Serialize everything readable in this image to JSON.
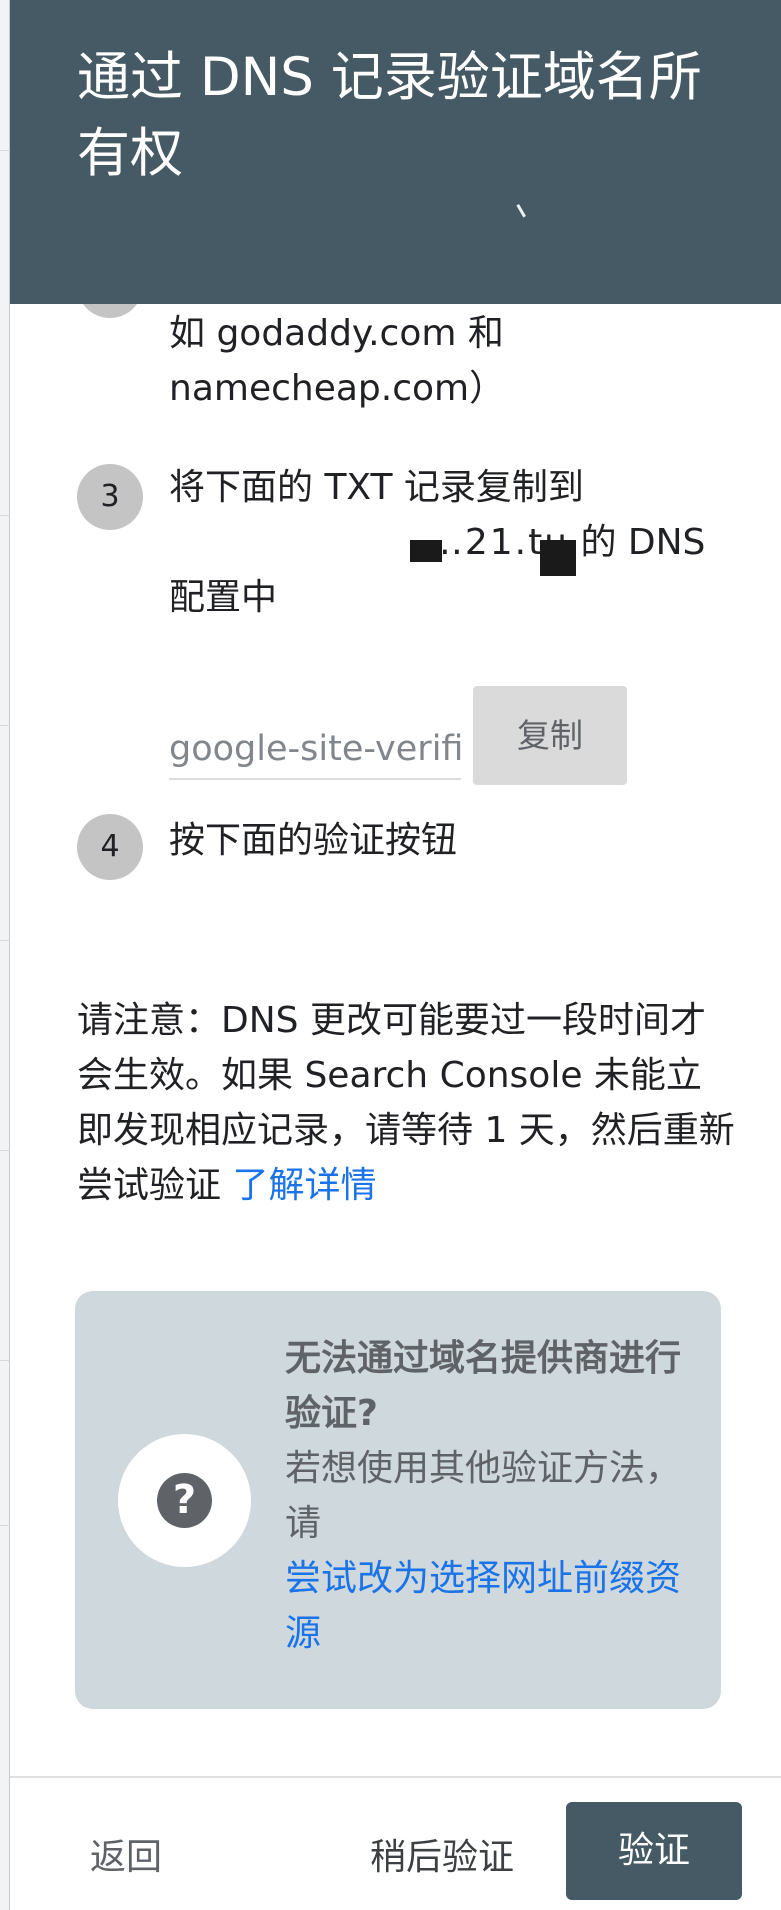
{
  "dialog": {
    "title": "通过 DNS 记录验证域名所有权"
  },
  "steps": {
    "step2_tail_line1": "如 godaddy.com 和",
    "step2_tail_line2": "namecheap.com）",
    "step3_number": "3",
    "step3_line1": "将下面的 TXT 记录复制到",
    "step3_domain_visible": "…21.tu",
    "step3_line2_suffix": "的 DNS",
    "step3_line3": "配置中",
    "txt_record_value": "google-site-verification",
    "copy_label": "复制",
    "step4_number": "4",
    "step4_text": "按下面的验证按钮"
  },
  "note": {
    "text": "请注意：DNS 更改可能要过一段时间才会生效。如果 Search Console 未能立即发现相应记录，请等待 1 天，然后重新尝试验证",
    "link": "了解详情"
  },
  "alternative": {
    "icon": "help-icon",
    "title": "无法通过域名提供商进行验证?",
    "text": "若想使用其他验证方法，请",
    "link": "尝试改为选择网址前缀资源"
  },
  "footer": {
    "back_label": "返回",
    "later_label": "稍后验证",
    "verify_label": "验证"
  },
  "colors": {
    "header_bg": "#455a64",
    "link": "#1a73e8",
    "card_bg": "#cfd8dc",
    "verify_bg": "#455a64"
  }
}
